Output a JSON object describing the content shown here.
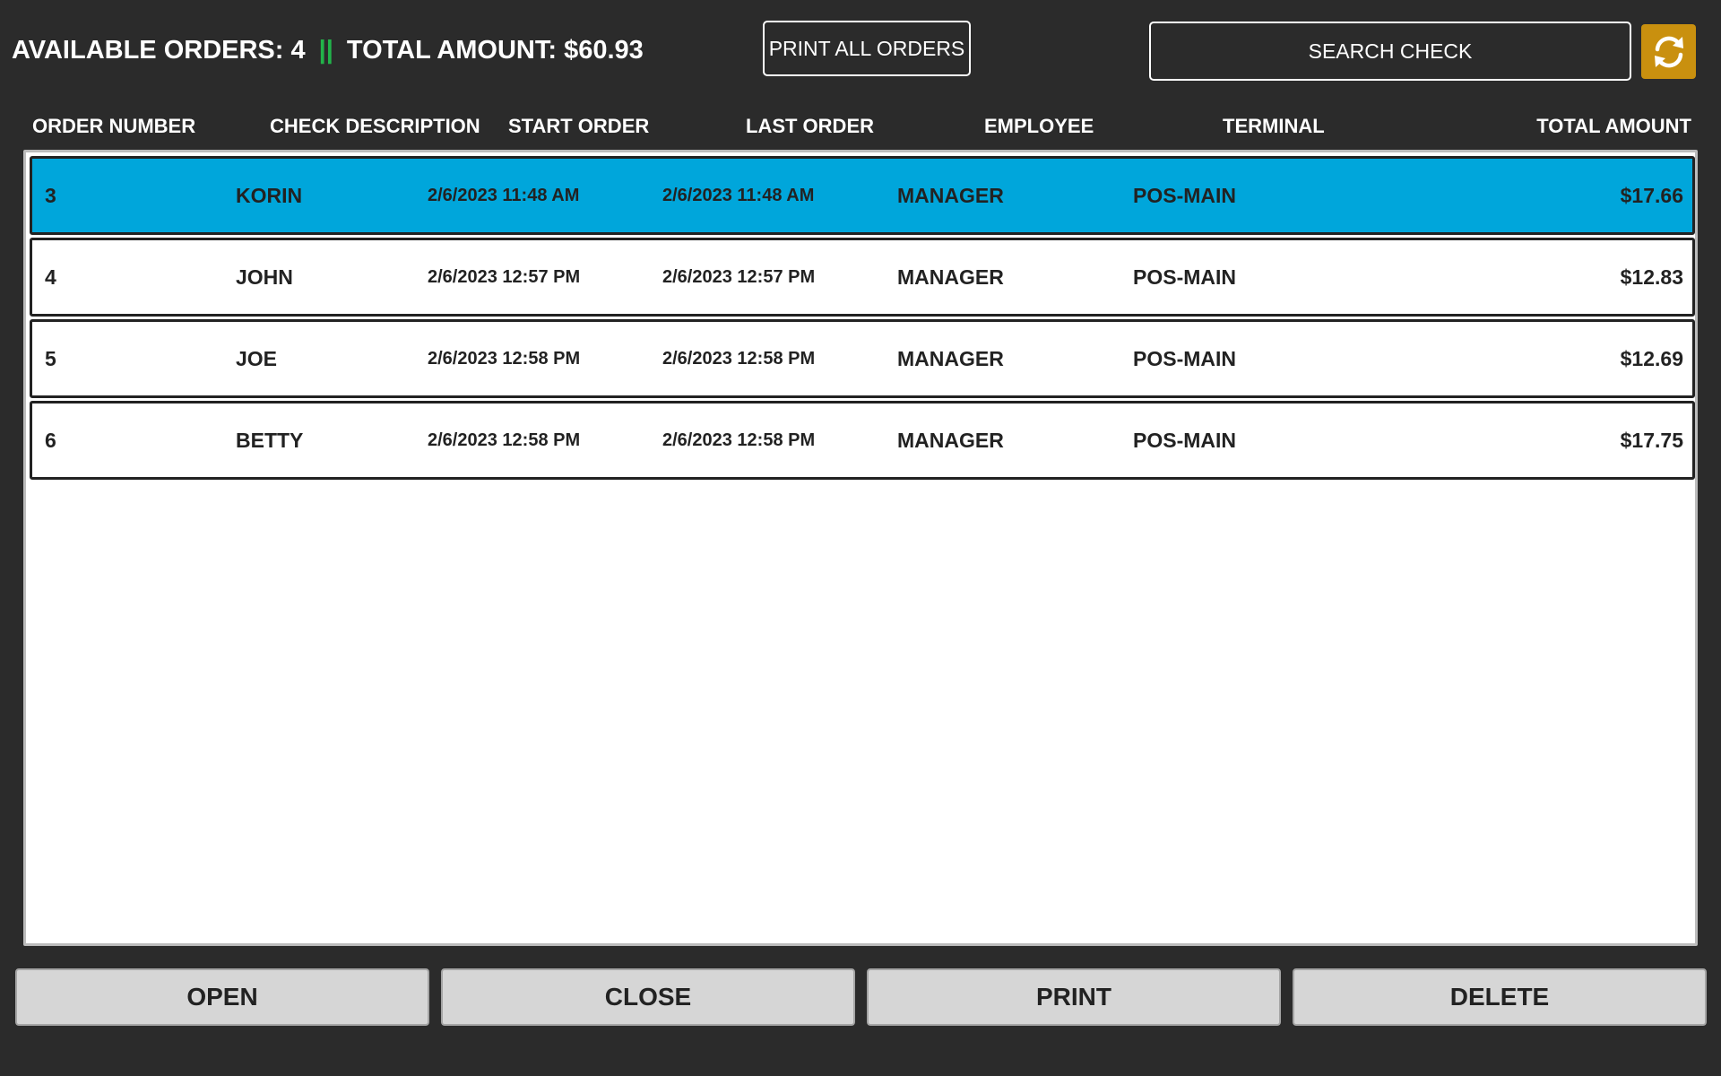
{
  "header": {
    "available_orders_label": "AVAILABLE ORDERS:",
    "available_orders_count": "4",
    "separator": "||",
    "total_amount_label": "TOTAL AMOUNT:",
    "total_amount_value": "$60.93",
    "print_all_label": "PRINT ALL ORDERS",
    "search_placeholder": "SEARCH CHECK",
    "refresh_icon": "refresh-icon"
  },
  "columns": [
    "ORDER NUMBER",
    "CHECK DESCRIPTION",
    "START ORDER",
    "LAST ORDER",
    "EMPLOYEE",
    "TERMINAL",
    "TOTAL AMOUNT"
  ],
  "orders": [
    {
      "number": "3",
      "description": "KORIN",
      "start": "2/6/2023 11:48 AM",
      "last": "2/6/2023 11:48 AM",
      "employee": "MANAGER",
      "terminal": "POS-MAIN",
      "total": "$17.66",
      "selected": true
    },
    {
      "number": "4",
      "description": "JOHN",
      "start": "2/6/2023 12:57 PM",
      "last": "2/6/2023 12:57 PM",
      "employee": "MANAGER",
      "terminal": "POS-MAIN",
      "total": "$12.83",
      "selected": false
    },
    {
      "number": "5",
      "description": "JOE",
      "start": "2/6/2023 12:58 PM",
      "last": "2/6/2023 12:58 PM",
      "employee": "MANAGER",
      "terminal": "POS-MAIN",
      "total": "$12.69",
      "selected": false
    },
    {
      "number": "6",
      "description": "BETTY",
      "start": "2/6/2023 12:58 PM",
      "last": "2/6/2023 12:58 PM",
      "employee": "MANAGER",
      "terminal": "POS-MAIN",
      "total": "$17.75",
      "selected": false
    }
  ],
  "actions": {
    "open": "OPEN",
    "close": "CLOSE",
    "print": "PRINT",
    "delete": "DELETE"
  },
  "colors": {
    "background": "#2b2b2b",
    "selected_row": "#00a6db",
    "refresh_button": "#c9900f",
    "separator": "#22b34a",
    "action_button": "#d6d6d6"
  }
}
